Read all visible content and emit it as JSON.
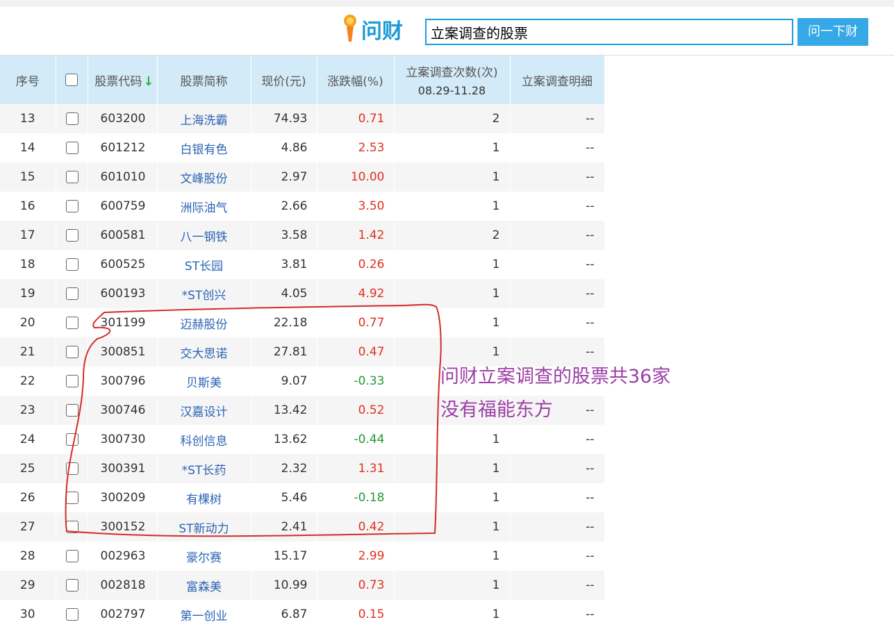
{
  "search": {
    "logo_text": "问财",
    "query": "立案调查的股票",
    "button_label": "问一下财"
  },
  "table": {
    "headers": {
      "index": "序号",
      "code": "股票代码",
      "sort_indicator": "↓",
      "name": "股票简称",
      "price": "现价(元)",
      "change": "涨跌幅(%)",
      "count": "立案调查次数(次)",
      "count_range": "08.29-11.28",
      "detail": "立案调查明细"
    },
    "rows": [
      {
        "index": "13",
        "code": "603200",
        "name": "上海洗霸",
        "price": "74.93",
        "change": "0.71",
        "dir": "up",
        "count": "2",
        "detail": "--"
      },
      {
        "index": "14",
        "code": "601212",
        "name": "白银有色",
        "price": "4.86",
        "change": "2.53",
        "dir": "up",
        "count": "1",
        "detail": "--"
      },
      {
        "index": "15",
        "code": "601010",
        "name": "文峰股份",
        "price": "2.97",
        "change": "10.00",
        "dir": "up",
        "count": "1",
        "detail": "--"
      },
      {
        "index": "16",
        "code": "600759",
        "name": "洲际油气",
        "price": "2.66",
        "change": "3.50",
        "dir": "up",
        "count": "1",
        "detail": "--"
      },
      {
        "index": "17",
        "code": "600581",
        "name": "八一钢铁",
        "price": "3.58",
        "change": "1.42",
        "dir": "up",
        "count": "2",
        "detail": "--"
      },
      {
        "index": "18",
        "code": "600525",
        "name": "ST长园",
        "price": "3.81",
        "change": "0.26",
        "dir": "up",
        "count": "1",
        "detail": "--"
      },
      {
        "index": "19",
        "code": "600193",
        "name": "*ST创兴",
        "price": "4.05",
        "change": "4.92",
        "dir": "up",
        "count": "1",
        "detail": "--"
      },
      {
        "index": "20",
        "code": "301199",
        "name": "迈赫股份",
        "price": "22.18",
        "change": "0.77",
        "dir": "up",
        "count": "1",
        "detail": "--"
      },
      {
        "index": "21",
        "code": "300851",
        "name": "交大思诺",
        "price": "27.81",
        "change": "0.47",
        "dir": "up",
        "count": "1",
        "detail": "--"
      },
      {
        "index": "22",
        "code": "300796",
        "name": "贝斯美",
        "price": "9.07",
        "change": "-0.33",
        "dir": "down",
        "count": "",
        "detail": ""
      },
      {
        "index": "23",
        "code": "300746",
        "name": "汉嘉设计",
        "price": "13.42",
        "change": "0.52",
        "dir": "up",
        "count": "",
        "detail": "--"
      },
      {
        "index": "24",
        "code": "300730",
        "name": "科创信息",
        "price": "13.62",
        "change": "-0.44",
        "dir": "down",
        "count": "1",
        "detail": "--"
      },
      {
        "index": "25",
        "code": "300391",
        "name": "*ST长药",
        "price": "2.32",
        "change": "1.31",
        "dir": "up",
        "count": "1",
        "detail": "--"
      },
      {
        "index": "26",
        "code": "300209",
        "name": "有棵树",
        "price": "5.46",
        "change": "-0.18",
        "dir": "down",
        "count": "1",
        "detail": "--"
      },
      {
        "index": "27",
        "code": "300152",
        "name": "ST新动力",
        "price": "2.41",
        "change": "0.42",
        "dir": "up",
        "count": "1",
        "detail": "--"
      },
      {
        "index": "28",
        "code": "002963",
        "name": "豪尔赛",
        "price": "15.17",
        "change": "2.99",
        "dir": "up",
        "count": "1",
        "detail": "--"
      },
      {
        "index": "29",
        "code": "002818",
        "name": "富森美",
        "price": "10.99",
        "change": "0.73",
        "dir": "up",
        "count": "1",
        "detail": "--"
      },
      {
        "index": "30",
        "code": "002797",
        "name": "第一创业",
        "price": "6.87",
        "change": "0.15",
        "dir": "up",
        "count": "1",
        "detail": "--"
      }
    ]
  },
  "annotation": {
    "line1": "问财立案调查的股票共36家",
    "line2": "没有福能东方",
    "color": "#9b3fa6",
    "circle_color": "#d42a2a"
  },
  "colors": {
    "header_bg": "#d3ebf8",
    "up": "#e0301e",
    "down": "#1f9a35",
    "link": "#2b64b4",
    "accent": "#1d9be1"
  }
}
